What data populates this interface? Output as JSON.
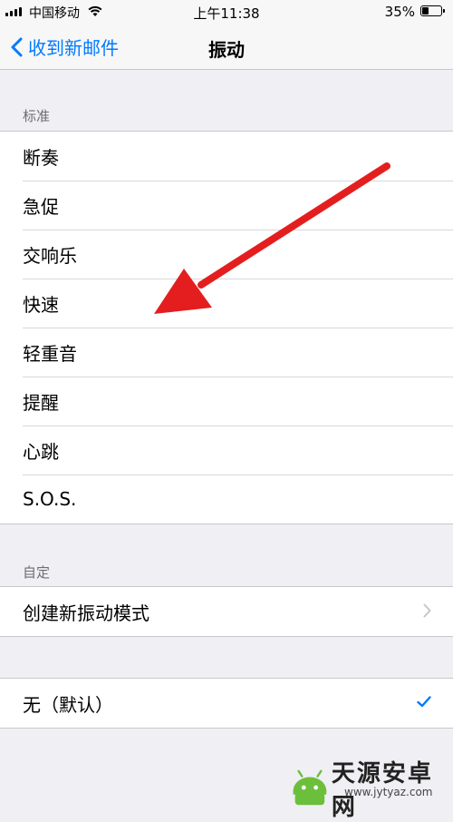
{
  "status_bar": {
    "carrier": "中国移动",
    "time": "上午11:38",
    "battery_percent": "35%",
    "battery_level": 0.35,
    "icons": [
      "signal-icon",
      "wifi-icon",
      "battery-icon"
    ]
  },
  "nav": {
    "back_label": "收到新邮件",
    "title": "振动"
  },
  "sections": {
    "standard": {
      "header": "标准",
      "items": [
        "断奏",
        "急促",
        "交响乐",
        "快速",
        "轻重音",
        "提醒",
        "心跳",
        "S.O.S."
      ]
    },
    "custom": {
      "header": "自定",
      "create_label": "创建新振动模式"
    },
    "none": {
      "label": "无（默认）",
      "selected": true
    }
  },
  "watermark": {
    "name": "天源安卓网",
    "url": "www.jytyaz.com"
  },
  "colors": {
    "accent": "#007aff",
    "annotation_arrow": "#e41e1e",
    "background": "#efeff4"
  }
}
